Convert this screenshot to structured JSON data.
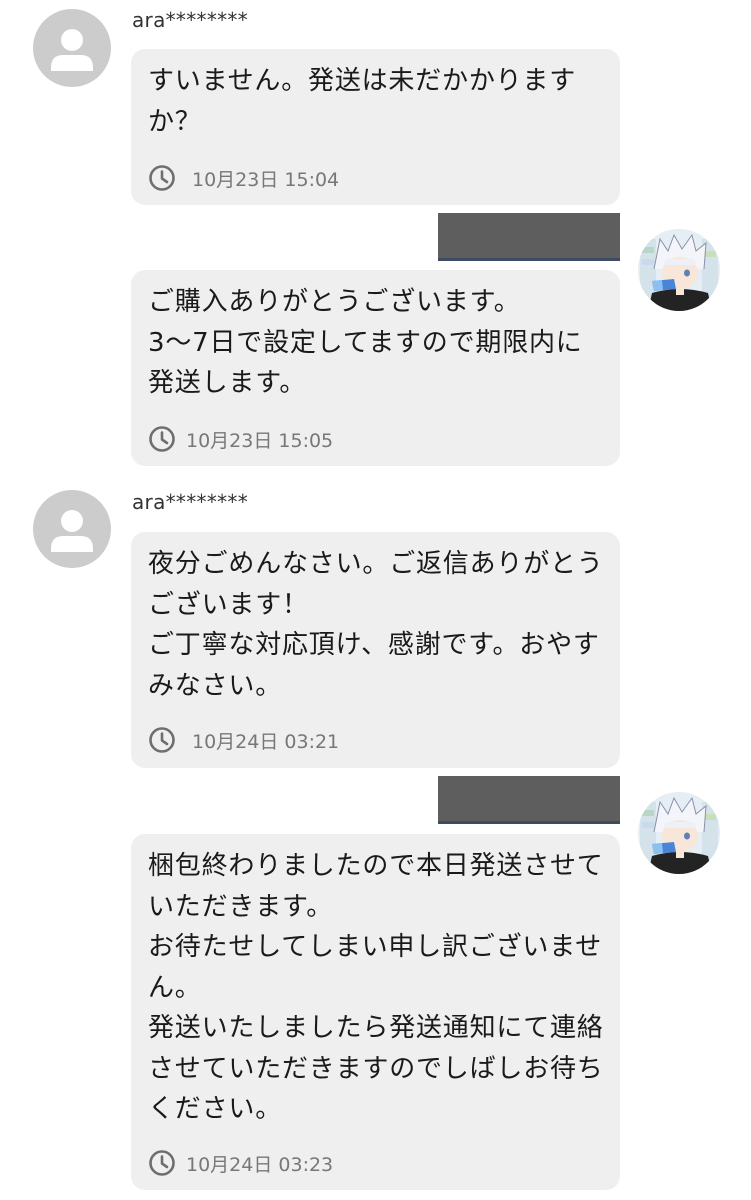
{
  "messages": [
    {
      "sender": "buyer",
      "username": "ara********",
      "text": "すいません。発送は未だかかります\nか？",
      "timestamp": "10月23日 15:04",
      "avatar_icon": "default-user-icon"
    },
    {
      "sender": "seller",
      "username_redacted": true,
      "text": "ご購入ありがとうございます。\n3〜7日で設定してますので期限内に\n発送します。",
      "timestamp": "10月23日 15:05",
      "avatar_icon": "anime-character-avatar"
    },
    {
      "sender": "buyer",
      "username": "ara********",
      "text": "夜分ごめんなさい。ご返信ありがとう\nございます！\nご丁寧な対応頂け、感謝です。おやす\nみなさい。",
      "timestamp": "10月24日 03:21",
      "avatar_icon": "default-user-icon"
    },
    {
      "sender": "seller",
      "username_redacted": true,
      "text": "梱包終わりましたので本日発送させて\nいただきます。\nお待たせしてしまい申し訳ございませ\nん。\n発送いたしましたら発送通知にて連絡\nさせていただきますのでしばしお待ち\nください。",
      "timestamp": "10月24日 03:23",
      "avatar_icon": "anime-character-avatar"
    }
  ],
  "colors": {
    "bubble": "#efefef",
    "avatar_default": "#cccccc",
    "redaction": "#5e5e5e",
    "timestamp": "#777777"
  }
}
